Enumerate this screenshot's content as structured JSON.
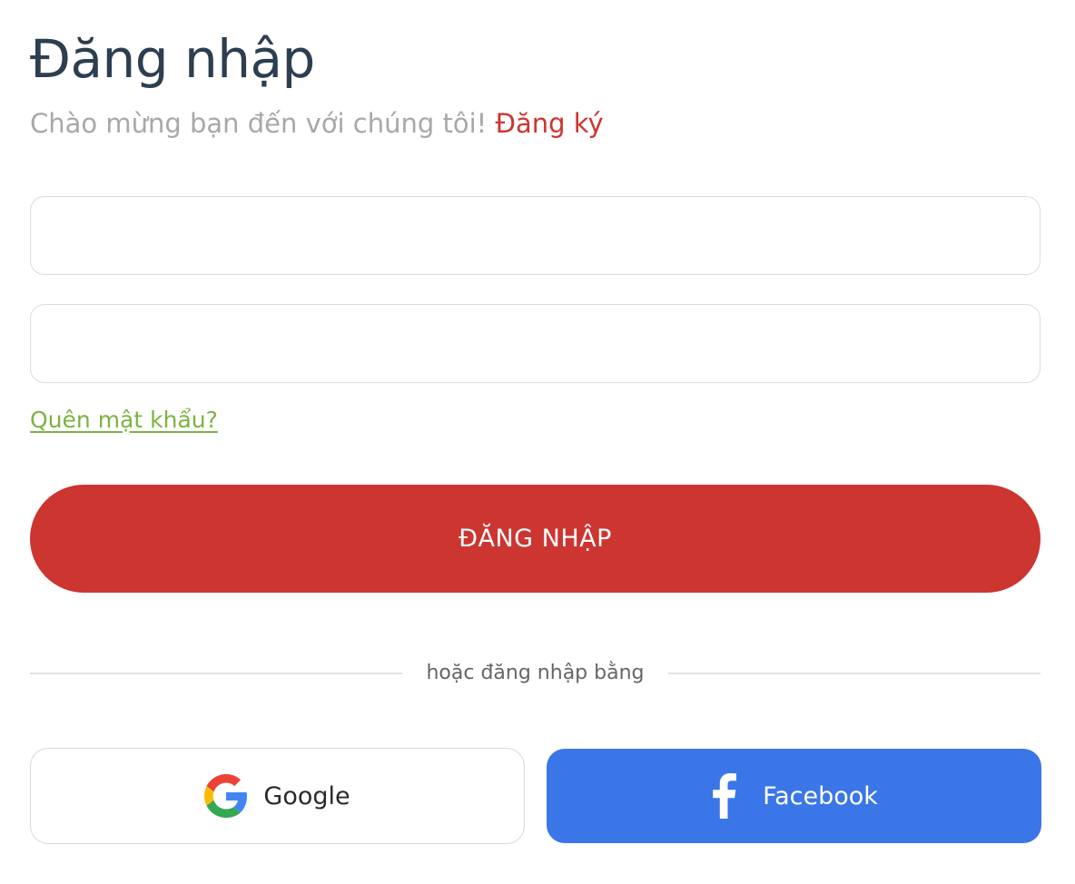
{
  "header": {
    "title": "Đăng nhập",
    "subtitle": "Chào mừng bạn đến với chúng tôi!",
    "signup_link": "Đăng ký"
  },
  "form": {
    "username_value": "",
    "password_value": "",
    "forgot_password_link": "Quên mật khẩu?",
    "submit_label": "ĐĂNG NHẬP"
  },
  "divider": {
    "label": "hoặc đăng nhập bằng"
  },
  "social": {
    "google": {
      "label": "Google",
      "icon": "google-icon"
    },
    "facebook": {
      "label": "Facebook",
      "icon": "facebook-icon"
    }
  },
  "colors": {
    "primary_red": "#cc3530",
    "link_green": "#7cb342",
    "facebook_blue": "#3a76e8",
    "title_dark": "#2c3e50"
  }
}
